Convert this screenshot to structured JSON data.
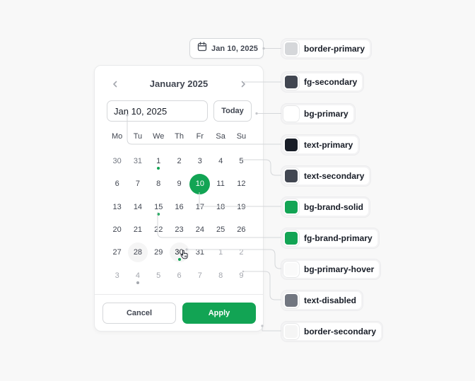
{
  "trigger": {
    "label": "Jan 10, 2025",
    "icon": "calendar-icon"
  },
  "calendar": {
    "month_title": "January 2025",
    "prev_icon": "chevron-left-icon",
    "next_icon": "chevron-right-icon",
    "date_input_value": "Jan 10, 2025",
    "today_label": "Today",
    "weekdays": [
      "Mo",
      "Tu",
      "We",
      "Th",
      "Fr",
      "Sa",
      "Su"
    ],
    "days": [
      {
        "n": "30",
        "state": "muted"
      },
      {
        "n": "31",
        "state": "muted"
      },
      {
        "n": "1",
        "dot": "green"
      },
      {
        "n": "2"
      },
      {
        "n": "3"
      },
      {
        "n": "4"
      },
      {
        "n": "5"
      },
      {
        "n": "6"
      },
      {
        "n": "7"
      },
      {
        "n": "8"
      },
      {
        "n": "9"
      },
      {
        "n": "10",
        "state": "selected"
      },
      {
        "n": "11"
      },
      {
        "n": "12"
      },
      {
        "n": "13"
      },
      {
        "n": "14"
      },
      {
        "n": "15",
        "dot": "green"
      },
      {
        "n": "16"
      },
      {
        "n": "17"
      },
      {
        "n": "18"
      },
      {
        "n": "19"
      },
      {
        "n": "20"
      },
      {
        "n": "21"
      },
      {
        "n": "22"
      },
      {
        "n": "23"
      },
      {
        "n": "24"
      },
      {
        "n": "25"
      },
      {
        "n": "26"
      },
      {
        "n": "27"
      },
      {
        "n": "28",
        "state": "hover"
      },
      {
        "n": "29"
      },
      {
        "n": "30",
        "state": "current-hover",
        "dot": "green"
      },
      {
        "n": "31"
      },
      {
        "n": "1",
        "state": "disabled"
      },
      {
        "n": "2",
        "state": "disabled"
      },
      {
        "n": "3",
        "state": "disabled"
      },
      {
        "n": "4",
        "state": "disabled",
        "dot": "grey"
      },
      {
        "n": "5",
        "state": "disabled"
      },
      {
        "n": "6",
        "state": "disabled"
      },
      {
        "n": "7",
        "state": "disabled"
      },
      {
        "n": "8",
        "state": "disabled"
      },
      {
        "n": "9",
        "state": "disabled"
      }
    ],
    "cancel_label": "Cancel",
    "apply_label": "Apply"
  },
  "tokens": [
    {
      "label": "border-primary",
      "color": "#d5d7da"
    },
    {
      "label": "fg-secondary",
      "color": "#414651"
    },
    {
      "label": "bg-primary",
      "color": "#ffffff"
    },
    {
      "label": "text-primary",
      "color": "#181d27"
    },
    {
      "label": "text-secondary",
      "color": "#414651"
    },
    {
      "label": "bg-brand-solid",
      "color": "#12a454"
    },
    {
      "label": "fg-brand-primary",
      "color": "#12a454"
    },
    {
      "label": "bg-primary-hover",
      "color": "#fafafa"
    },
    {
      "label": "text-disabled",
      "color": "#717680"
    },
    {
      "label": "border-secondary",
      "color": "#f5f5f5"
    }
  ],
  "colors": {
    "brand": "#12a454",
    "page_background": "#f8f8f8"
  }
}
